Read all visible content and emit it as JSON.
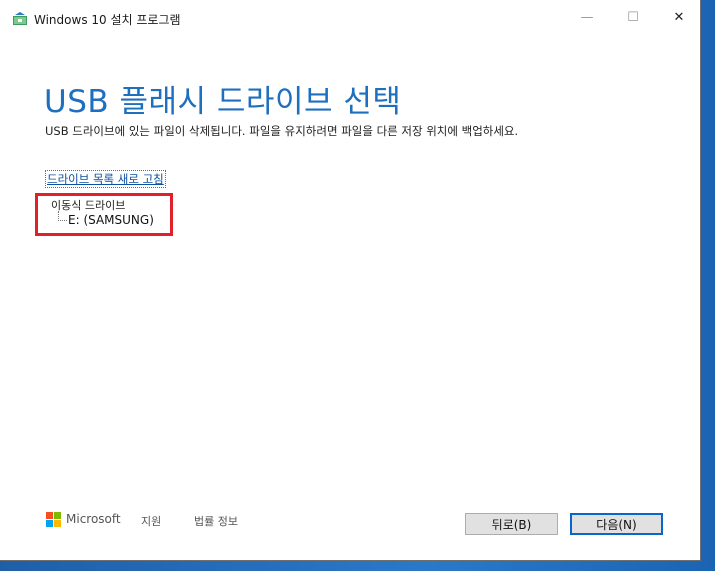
{
  "window": {
    "title": "Windows 10 설치 프로그램",
    "controls": {
      "minimize": "—",
      "maximize": "☐",
      "close": "✕"
    }
  },
  "main": {
    "heading": "USB 플래시 드라이브 선택",
    "subtitle": "USB 드라이브에 있는 파일이 삭제됩니다. 파일을 유지하려면 파일을 다른 저장 위치에 백업하세요.",
    "refresh_link": "드라이브 목록 새로 고침",
    "drive_tree": {
      "group_label": "이동식 드라이브",
      "items": [
        "E: (SAMSUNG)"
      ]
    }
  },
  "footer": {
    "brand": "Microsoft",
    "support": "지원",
    "legal": "법률 정보"
  },
  "buttons": {
    "back": "뒤로(B)",
    "next": "다음(N)"
  },
  "colors": {
    "heading": "#1f6fbf",
    "highlight": "#e0202a",
    "default_button_border": "#0a66c8"
  }
}
